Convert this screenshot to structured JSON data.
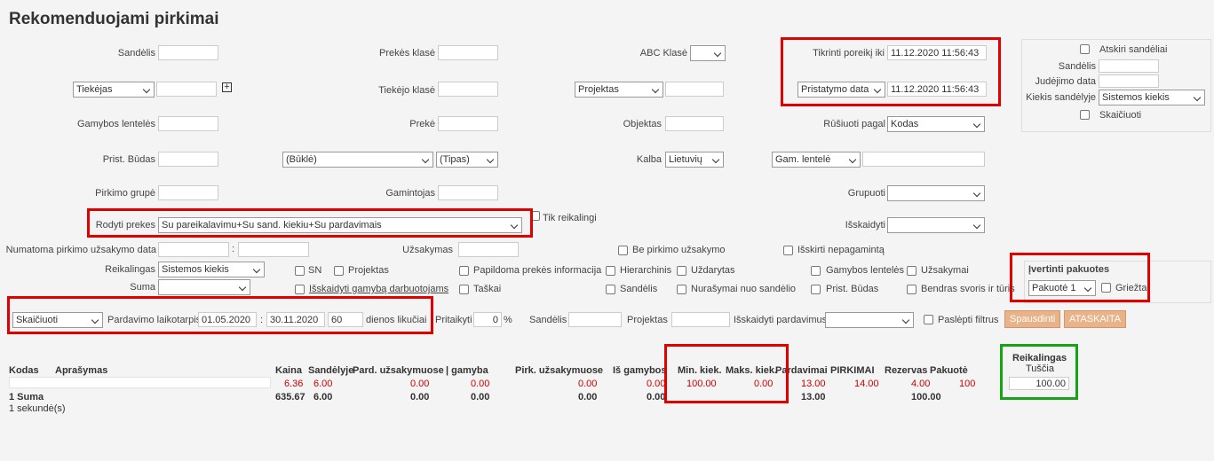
{
  "title": "Rekomenduojami pirkimai",
  "row1": {
    "sandelis": "Sandėlis",
    "prekes_klase": "Prekės klasė",
    "abc_klase": "ABC Klasė",
    "tikrinti": "Tikrinti poreikį iki",
    "tikrinti_val": "11.12.2020 11:56:43"
  },
  "row2": {
    "tiekejas": "Tiekėjas",
    "tiekejo_klase": "Tiekėjo klasė",
    "projektas": "Projektas",
    "pristatymo": "Pristatymo data",
    "pristatymo_val": "11.12.2020 11:56:43"
  },
  "row3": {
    "gamybos": "Gamybos lentelės",
    "preke": "Prekė",
    "objektas": "Objektas",
    "rusiuoti": "Rūšiuoti pagal",
    "rusiuoti_val": "Kodas"
  },
  "row4": {
    "prist_budas": "Prist. Būdas",
    "bukle": "(Būklė)",
    "tipas": "(Tipas)",
    "kalba": "Kalba",
    "kalba_val": "Lietuvių",
    "gam_lentele": "Gam. lentelė"
  },
  "row5": {
    "pirkimo_grupe": "Pirkimo grupė",
    "gamintojas": "Gamintojas",
    "grupuoti": "Grupuoti"
  },
  "row6": {
    "rodyti": "Rodyti prekes",
    "rodyti_val": "Su pareikalavimu+Su sand. kiekiu+Su pardavimais",
    "tik": "Tik reikalingi",
    "isskaidyti": "Išskaidyti"
  },
  "side": {
    "atskiri": "Atskiri sandėliai",
    "sandelis": "Sandėlis",
    "judejimo": "Judėjimo data",
    "kiekis": "Kiekis sandėlyje",
    "kiekis_val": "Sistemos kiekis",
    "skaiciuoti": "Skaičiuoti"
  },
  "row7": {
    "numatoma": "Numatoma pirkimo užsakymo data",
    "sep": ":",
    "uzsakymas": "Užsakymas",
    "be_pirkimo": "Be pirkimo užsakymo",
    "isskirti": "Išskirti nepagamintą"
  },
  "row8": {
    "reikalingas": "Reikalingas",
    "reikalingas_val": "Sistemos kiekis",
    "sn": "SN",
    "projektas": "Projektas",
    "papildoma": "Papildoma prekės informacija",
    "hierarchinis": "Hierarchinis",
    "uzdarytas": "Uždarytas",
    "gamybos": "Gamybos lentelės",
    "uzsakymai": "Užsakymai",
    "ivertinti": "Įvertinti pakuotes"
  },
  "row9": {
    "suma": "Suma",
    "isskaidyti_gam": "Išskaidyti gamybą darbuotojams",
    "taskai": "Taškai",
    "sandelis": "Sandėlis",
    "nurasymai": "Nurašymai nuo sandėlio",
    "prist_budas": "Prist. Būdas",
    "bendras": "Bendras svoris ir tūris",
    "pakuote": "Pakuotė 1",
    "griezta": "Griežta"
  },
  "row10": {
    "skaiciuoti": "Skaičiuoti",
    "pardavimo": "Pardavimo laikotarpis",
    "nuo": "01.05.2020",
    "sep": ":",
    "iki": "30.11.2020",
    "dienos": "60",
    "dienos_lbl": "dienos likučiai",
    "pritaikyti": "Pritaikyti",
    "proc": "0",
    "proc_unit": "%",
    "sandelis": "Sandėlis",
    "projektas": "Projektas",
    "isskaidyti_pard": "Išskaidyti pardavimus",
    "pasl": "Paslėpti filtrus",
    "spausdinti": "Spausdinti",
    "ataskaita": "ATASKAITA"
  },
  "table": {
    "headers": [
      "Kodas",
      "Aprašymas",
      "Kaina",
      "Sandėlyje",
      "Pard. užsakymuose",
      "| gamyba",
      "Pirk. užsakymuose",
      "Iš gamybos",
      "Min. kiek.",
      "Maks. kiek.",
      "Pardavimai",
      "PIRKIMAI",
      "Rezervas",
      "Pakuotė",
      "Reikalingas"
    ],
    "reik_sub": "Tuščia",
    "row": {
      "kaina": "6.36",
      "sandelyje": "6.00",
      "pard": "0.00",
      "gamyba": "0.00",
      "pirk": "0.00",
      "is_gam": "0.00",
      "min": "100.00",
      "maks": "0.00",
      "pardavimai": "13.00",
      "pirkimai": "14.00",
      "rezervas": "4.00",
      "pakuote": "100",
      "reikalingas": "100.00"
    },
    "sum": {
      "label": "1 Suma",
      "kaina": "635.67",
      "sandelyje": "6.00",
      "pard": "0.00",
      "gamyba": "0.00",
      "pirk": "0.00",
      "is_gam": "0.00",
      "pardavimai": "13.00",
      "rezervas": "100.00"
    },
    "time": "1 sekundė(s)"
  },
  "colors": {
    "highlight_red": "#e00000",
    "highlight_green": "#16a316",
    "button": "#e9b38a"
  }
}
